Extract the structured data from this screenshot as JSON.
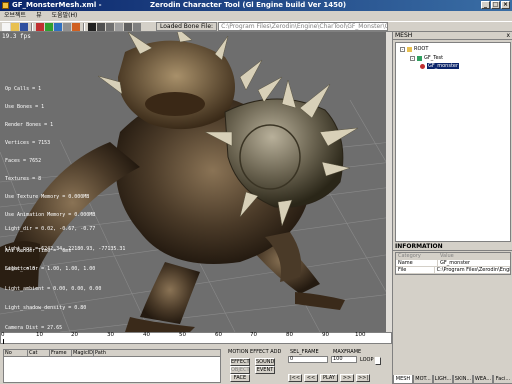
{
  "window": {
    "title": "GF_MonsterMesh.xml - ",
    "app_title": "Zerodin Character Tool (Gl Engine build Ver 1450)"
  },
  "menu": [
    "오브젝트",
    "뷰",
    "도움말(H)"
  ],
  "toolbar": {
    "loaded_label": "Loaded Bone File:",
    "loaded_path": "C:\\Program Files\\Zerodin\\Engine\\CharTool\\GF_Monster\\GF_monster.bone"
  },
  "viewport": {
    "fps": "19.3 fps",
    "stats": [
      "Op Calls = 1",
      "Use Bones = 1",
      "Render Bones = 1",
      "Vertices = 7153",
      "Faces = 7652",
      "Textures = 8",
      "Use Texture Memory = 0.000MB",
      "Use Animation Memory = 0.000MB",
      "",
      "Ani Render Time =  0ms",
      "Select = 0"
    ],
    "lights": [
      "Light_dir = 0.02, -0.67, -0.77",
      "Light_pos = 6242.34, 22180.93, -77135.31",
      "Light_color = 1.00, 1.00, 1.00",
      "Light_ambient = 0.00, 0.00, 0.00",
      "Light_shadow_density = 0.80",
      "Camera Dist = 27.65"
    ]
  },
  "timeline": {
    "ticks": [
      "0",
      "10",
      "20",
      "30",
      "40",
      "50",
      "60",
      "70",
      "80",
      "90",
      "100"
    ]
  },
  "bottom": {
    "grid_headers": [
      "No",
      "Cat",
      "Frame",
      "MagicID",
      "Path"
    ],
    "motion_effect_label": "MOTION EFFECT ADD",
    "buttons": {
      "effect": "EFFECT",
      "sound": "SOUND",
      "object": "OBJECT",
      "event": "EVENT",
      "face": "FACE"
    },
    "sel_frame_label": "SEL_FRAME",
    "max_frame_label": "MAXFRAME",
    "sel_frame_value": "0",
    "max_frame_value": "100",
    "loop_label": "LOOP",
    "playback": {
      "first": "|<<",
      "prev": "<<",
      "play": "PLAY",
      "next": ">>",
      "last": ">>|"
    }
  },
  "mesh_panel": {
    "title": "MESH",
    "close": "x",
    "tree": [
      {
        "label": "ROOT",
        "level": 0
      },
      {
        "label": "GF_Test",
        "level": 1
      },
      {
        "label": "GF_monster",
        "level": 2,
        "selected": true
      }
    ]
  },
  "info_panel": {
    "title": "INFORMATION",
    "header": [
      "Category",
      "Value"
    ],
    "rows": [
      {
        "key": "Name",
        "value": "GF_monster"
      },
      {
        "key": "File",
        "value": "C:\\Program Files\\Zerodin\\Engine"
      }
    ]
  },
  "right_tabs": [
    "MESH",
    "MOT...",
    "LIGH...",
    "SKIN...",
    "WEA...",
    "Faci..."
  ]
}
